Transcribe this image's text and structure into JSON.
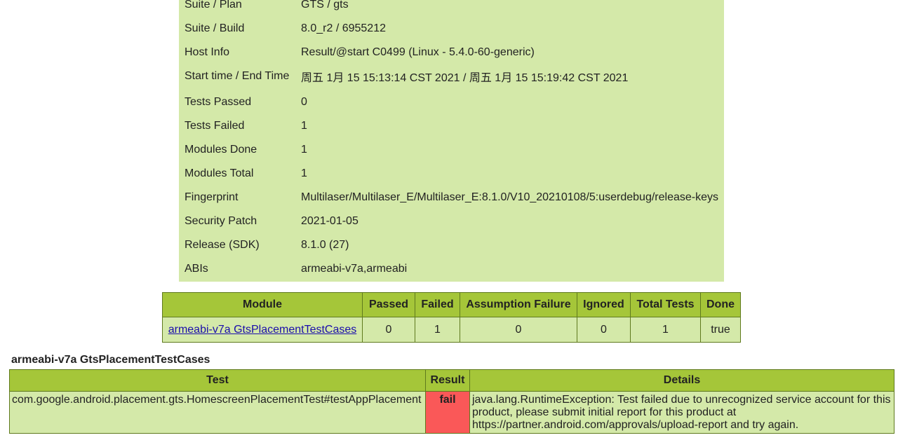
{
  "summary": [
    {
      "label": "Suite / Plan",
      "value": "GTS / gts"
    },
    {
      "label": "Suite / Build",
      "value": "8.0_r2 / 6955212"
    },
    {
      "label": "Host Info",
      "value": "Result/@start C0499 (Linux - 5.4.0-60-generic)"
    },
    {
      "label": "Start time / End Time",
      "value": "周五 1月 15 15:13:14 CST 2021 / 周五 1月 15 15:19:42 CST 2021"
    },
    {
      "label": "Tests Passed",
      "value": "0"
    },
    {
      "label": "Tests Failed",
      "value": "1"
    },
    {
      "label": "Modules Done",
      "value": "1"
    },
    {
      "label": "Modules Total",
      "value": "1"
    },
    {
      "label": "Fingerprint",
      "value": "Multilaser/Multilaser_E/Multilaser_E:8.1.0/V10_20210108/5:userdebug/release-keys"
    },
    {
      "label": "Security Patch",
      "value": "2021-01-05"
    },
    {
      "label": "Release (SDK)",
      "value": "8.1.0 (27)"
    },
    {
      "label": "ABIs",
      "value": "armeabi-v7a,armeabi"
    }
  ],
  "modules_table": {
    "headers": [
      "Module",
      "Passed",
      "Failed",
      "Assumption Failure",
      "Ignored",
      "Total Tests",
      "Done"
    ],
    "rows": [
      {
        "module": "armeabi-v7a GtsPlacementTestCases",
        "passed": "0",
        "failed": "1",
        "assumption_failure": "0",
        "ignored": "0",
        "total_tests": "1",
        "done": "true"
      }
    ]
  },
  "module_section": {
    "title": "armeabi-v7a GtsPlacementTestCases",
    "headers": [
      "Test",
      "Result",
      "Details"
    ],
    "rows": [
      {
        "test": "com.google.android.placement.gts.HomescreenPlacementTest#testAppPlacement",
        "result": "fail",
        "details": "java.lang.RuntimeException: Test failed due to unrecognized service account for this product, please submit initial report for this product at https://partner.android.com/approvals/upload-report and try again."
      }
    ]
  },
  "colors": {
    "summary_bg": "#d4e9a9",
    "header_bg": "#a5c639",
    "fail_bg": "#fa5858",
    "link": "#1a0dab"
  }
}
